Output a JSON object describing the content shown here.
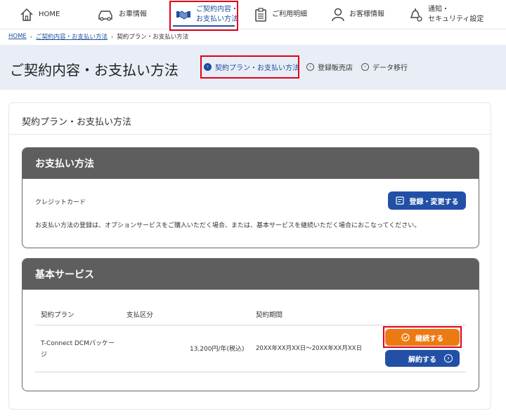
{
  "nav": {
    "items": [
      {
        "label": "HOME",
        "icon": "home-icon"
      },
      {
        "label": "お車情報",
        "icon": "car-icon"
      },
      {
        "label": "ご契約内容・\nお支払い方法",
        "icon": "handshake-icon"
      },
      {
        "label": "ご利用明細",
        "icon": "clipboard-icon"
      },
      {
        "label": "お客様情報",
        "icon": "user-icon"
      },
      {
        "label": "通知・\nセキュリティ設定",
        "icon": "bell-gear-icon"
      }
    ]
  },
  "breadcrumb": {
    "home": "HOME",
    "parent": "ご契約内容・お支払い方法",
    "current": "契約プラン・お支払い方法"
  },
  "header": {
    "title": "ご契約内容・お支払い方法",
    "subnav": [
      {
        "label": "契約プラン・お支払い方法"
      },
      {
        "label": "登録販売店"
      },
      {
        "label": "データ移行"
      }
    ]
  },
  "card": {
    "title": "契約プラン・お支払い方法"
  },
  "payment": {
    "heading": "お支払い方法",
    "method": "クレジットカード",
    "button": "登録・変更する",
    "note": "お支払い方法の登録は、オプションサービスをご購入いただく場合、または、基本サービスを継続いただく場合におこなってください。"
  },
  "basic": {
    "heading": "基本サービス",
    "columns": [
      "契約プラン",
      "支払区分",
      "契約期間"
    ],
    "row": {
      "plan": "T-Connect DCMパッケージ",
      "price": "13,200円/年(税込)",
      "period": "20XX年XX月XX日～20XX年XX月XX日"
    },
    "continue_button": "継続する",
    "cancel_button": "解約する"
  },
  "colors": {
    "accent": "#1d4e9e",
    "button_blue": "#2250a6",
    "button_orange": "#ec7a13",
    "panel_header": "#5e5e5e",
    "highlight": "#e0001a"
  }
}
